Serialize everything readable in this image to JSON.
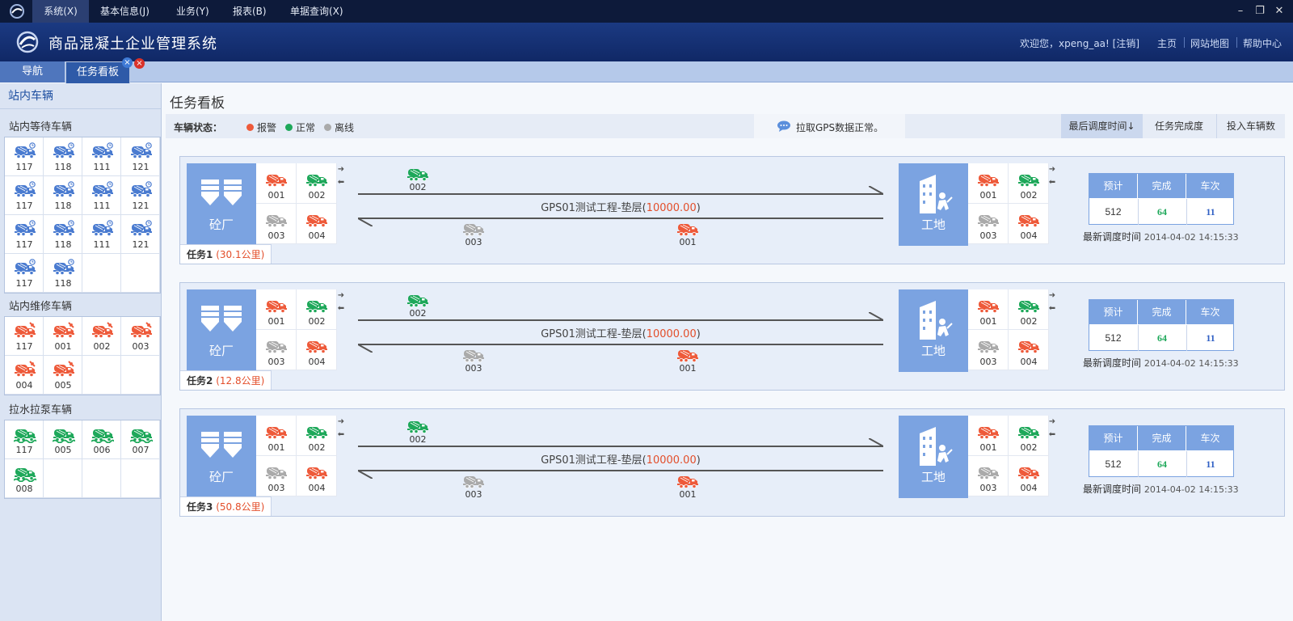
{
  "menubar": {
    "items": [
      "系统(X)",
      "基本信息(J)",
      "业务(Y)",
      "报表(B)",
      "单据查询(X)"
    ]
  },
  "header": {
    "title": "商品混凝土企业管理系统",
    "welcome": "欢迎您，xpeng_aa! [注销]",
    "links": [
      "主页",
      "网站地图",
      "帮助中心"
    ]
  },
  "tabs": [
    "导航",
    "任务看板"
  ],
  "sidebar": {
    "title": "站内车辆",
    "sections": [
      {
        "title": "站内等待车辆",
        "kind": "waiting",
        "vehicles": [
          "117",
          "118",
          "111",
          "121",
          "117",
          "118",
          "111",
          "121",
          "117",
          "118",
          "111",
          "121",
          "117",
          "118"
        ]
      },
      {
        "title": "站内维修车辆",
        "kind": "repair",
        "vehicles": [
          "117",
          "001",
          "002",
          "003",
          "004",
          "005"
        ]
      },
      {
        "title": "拉水拉泵车辆",
        "kind": "pump",
        "vehicles": [
          "117",
          "005",
          "006",
          "007",
          "008"
        ]
      }
    ]
  },
  "main": {
    "title": "任务看板",
    "status_label": "车辆状态：",
    "legend": [
      {
        "label": "报警",
        "color": "#ee5a3a"
      },
      {
        "label": "正常",
        "color": "#1ea85a"
      },
      {
        "label": "离线",
        "color": "#aaaaaa"
      }
    ],
    "gps_message": "拉取GPS数据正常。",
    "sort_buttons": [
      "最后调度时间↓",
      "任务完成度",
      "投入车辆数"
    ]
  },
  "colors": {
    "alarm": "#ee5a3a",
    "normal": "#1ea85a",
    "offline": "#aaaaaa",
    "blue": "#4a7bd0"
  },
  "tasks": [
    {
      "name": "任务1",
      "distance": "(30.1公里)",
      "plant": "砼厂",
      "site": "工地",
      "plant_vehicles": [
        {
          "id": "001",
          "s": "alarm"
        },
        {
          "id": "002",
          "s": "normal"
        },
        {
          "id": "003",
          "s": "offline"
        },
        {
          "id": "004",
          "s": "alarm"
        }
      ],
      "site_vehicles": [
        {
          "id": "001",
          "s": "alarm"
        },
        {
          "id": "002",
          "s": "normal"
        },
        {
          "id": "003",
          "s": "offline"
        },
        {
          "id": "004",
          "s": "alarm"
        }
      ],
      "route_prefix": "GPS01测试工程-垫层(",
      "route_amount": "10000.00",
      "route_suffix": ")",
      "outbound": [
        {
          "id": "002",
          "s": "normal"
        }
      ],
      "inbound": [
        {
          "id": "003",
          "s": "offline"
        },
        {
          "id": "001",
          "s": "alarm"
        }
      ],
      "stats_headers": [
        "预计",
        "完成",
        "车次"
      ],
      "stats_values": [
        "512",
        "64",
        "11"
      ],
      "updated_label": "最新调度时间",
      "updated_time": "2014-04-02 14:15:33"
    },
    {
      "name": "任务2",
      "distance": "(12.8公里)",
      "plant": "砼厂",
      "site": "工地",
      "plant_vehicles": [
        {
          "id": "001",
          "s": "alarm"
        },
        {
          "id": "002",
          "s": "normal"
        },
        {
          "id": "003",
          "s": "offline"
        },
        {
          "id": "004",
          "s": "alarm"
        }
      ],
      "site_vehicles": [
        {
          "id": "001",
          "s": "alarm"
        },
        {
          "id": "002",
          "s": "normal"
        },
        {
          "id": "003",
          "s": "offline"
        },
        {
          "id": "004",
          "s": "alarm"
        }
      ],
      "route_prefix": "GPS01测试工程-垫层(",
      "route_amount": "10000.00",
      "route_suffix": ")",
      "outbound": [
        {
          "id": "002",
          "s": "normal"
        }
      ],
      "inbound": [
        {
          "id": "003",
          "s": "offline"
        },
        {
          "id": "001",
          "s": "alarm"
        }
      ],
      "stats_headers": [
        "预计",
        "完成",
        "车次"
      ],
      "stats_values": [
        "512",
        "64",
        "11"
      ],
      "updated_label": "最新调度时间",
      "updated_time": "2014-04-02 14:15:33"
    },
    {
      "name": "任务3",
      "distance": "(50.8公里)",
      "plant": "砼厂",
      "site": "工地",
      "plant_vehicles": [
        {
          "id": "001",
          "s": "alarm"
        },
        {
          "id": "002",
          "s": "normal"
        },
        {
          "id": "003",
          "s": "offline"
        },
        {
          "id": "004",
          "s": "alarm"
        }
      ],
      "site_vehicles": [
        {
          "id": "001",
          "s": "alarm"
        },
        {
          "id": "002",
          "s": "normal"
        },
        {
          "id": "003",
          "s": "offline"
        },
        {
          "id": "004",
          "s": "alarm"
        }
      ],
      "route_prefix": "GPS01测试工程-垫层(",
      "route_amount": "10000.00",
      "route_suffix": ")",
      "outbound": [
        {
          "id": "002",
          "s": "normal"
        }
      ],
      "inbound": [
        {
          "id": "003",
          "s": "offline"
        },
        {
          "id": "001",
          "s": "alarm"
        }
      ],
      "stats_headers": [
        "预计",
        "完成",
        "车次"
      ],
      "stats_values": [
        "512",
        "64",
        "11"
      ],
      "updated_label": "最新调度时间",
      "updated_time": "2014-04-02 14:15:33"
    }
  ]
}
